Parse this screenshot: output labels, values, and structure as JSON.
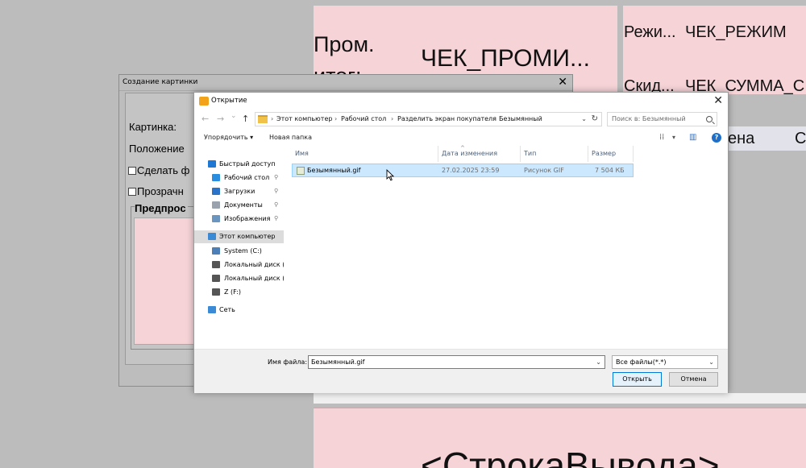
{
  "background": {
    "promo_label_line1": "Пром.",
    "promo_label_line2": "итог:",
    "promo_value": "ЧЕК_ПРОМИ...",
    "mode_label": "Режи...",
    "mode_value": "ЧЕК_РЕЖИМ",
    "discount_label": "Скид...",
    "discount_value": "ЧЕК_СУММА_С",
    "price_header": "ена",
    "right_header_fragment": "С",
    "output_line": "<СтрокаВывода>"
  },
  "picture_dialog": {
    "title": "Создание картинки",
    "close_glyph": "✕",
    "image_label": "Картинка:",
    "position_label": "Положение",
    "make_checkbox_label": "Сделать ф",
    "transparent_checkbox_label": "Прозрачн",
    "preview_label": "Предпрос"
  },
  "open_dialog": {
    "title": "Открытие",
    "close_glyph": "✕",
    "nav": {
      "back": "←",
      "forward": "→",
      "dropdown": "⌄",
      "up": "↑"
    },
    "breadcrumbs": [
      "Этот компьютер",
      "Рабочий стол",
      "Разделить экран покупателя",
      "Безымянный"
    ],
    "breadcrumb_separator": "›",
    "address_dropdown": "⌄",
    "refresh_glyph": "↻",
    "search_placeholder": "Поиск в: Безымянный",
    "toolbar": {
      "organize_label": "Упорядочить",
      "organize_arrow": "▾",
      "new_folder_label": "Новая папка",
      "view_glyph": "⁞⁞",
      "view_arrow": "▾",
      "preview_pane_glyph": "▥",
      "help_glyph": "?"
    },
    "nav_pane": [
      {
        "label": "Быстрый доступ",
        "pinned": false,
        "color": "#1e78d4"
      },
      {
        "label": "Рабочий стол",
        "pinned": true,
        "color": "#2b8de0"
      },
      {
        "label": "Загрузки",
        "pinned": true,
        "color": "#2b73c9"
      },
      {
        "label": "Документы",
        "pinned": true,
        "color": "#9aa3ad"
      },
      {
        "label": "Изображения",
        "pinned": true,
        "color": "#6b95c1"
      },
      {
        "label": "Этот компьютер",
        "pinned": false,
        "color": "#3a8ad6"
      },
      {
        "label": "System (C:)",
        "pinned": false,
        "color": "#4c7fb8"
      },
      {
        "label": "Локальный диск (D",
        "pinned": false,
        "color": "#555555"
      },
      {
        "label": "Локальный диск (E",
        "pinned": false,
        "color": "#555555"
      },
      {
        "label": "Z (F:)",
        "pinned": false,
        "color": "#555555"
      },
      {
        "label": "Сеть",
        "pinned": false,
        "color": "#3a8ad6"
      }
    ],
    "pin_glyph": "📌",
    "columns": [
      "Имя",
      "Дата изменения",
      "Тип",
      "Размер"
    ],
    "sort_glyph": "^",
    "files": [
      {
        "name": "Безымянный.gif",
        "date": "27.02.2025 23:59",
        "type": "Рисунок GIF",
        "size": "7 504 КБ"
      }
    ],
    "filename_label": "Имя файла:",
    "filename_value": "Безымянный.gif",
    "filetype_value": "Все файлы(*.*)",
    "combo_arrow": "⌄",
    "open_button": "Открыть",
    "cancel_button": "Отмена"
  }
}
